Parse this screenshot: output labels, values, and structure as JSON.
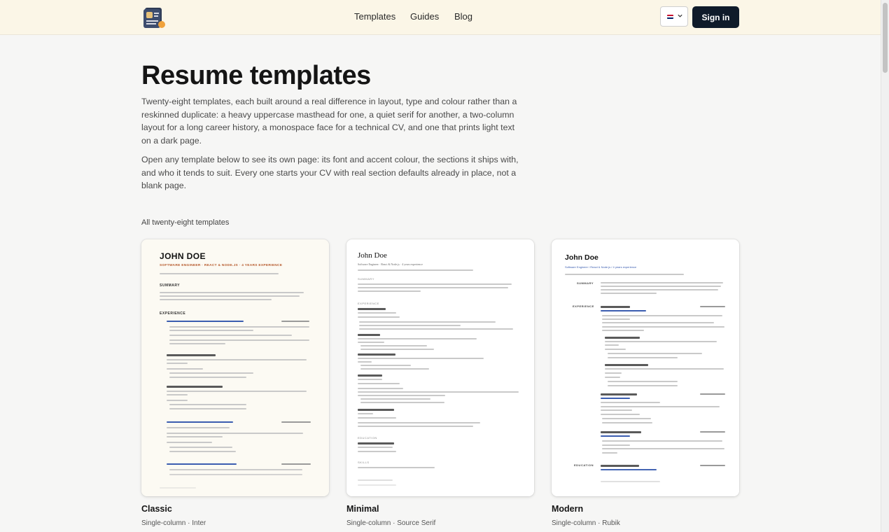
{
  "header": {
    "nav": [
      "Templates",
      "Guides",
      "Blog"
    ],
    "signin_label": "Sign in",
    "language_flag": "uk-flag"
  },
  "hero": {
    "title": "Resume templates",
    "paragraph1": "Twenty-eight templates, each built around a real difference in layout, type and colour rather than a reskinned duplicate: a heavy uppercase masthead for one, a quiet serif for another, a two-column layout for a long career history, a monospace face for a technical CV, and one that prints light text on a dark page.",
    "paragraph2": "Open any template below to see its own page: its font and accent colour, the sections it ships with, and who it tends to suit. Every one starts your CV with real section defaults already in place, not a blank page."
  },
  "gallery": {
    "count_label": "All twenty-eight templates",
    "templates": [
      {
        "name": "Classic",
        "meta": "Single-column · Inter",
        "preview": {
          "name": "JOHN DOE",
          "headline": "SOFTWARE ENGINEER · REACT & NODE.JS · 4 YEARS EXPERIENCE",
          "sections": [
            "SUMMARY",
            "EXPERIENCE"
          ],
          "accent": "#b65a2c"
        }
      },
      {
        "name": "Minimal",
        "meta": "Single-column · Source Serif",
        "preview": {
          "name": "John Doe",
          "headline": "Software Engineer · React & Node.js · 4 years experience",
          "sections": [
            "SUMMARY",
            "EXPERIENCE",
            "EDUCATION",
            "SKILLS"
          ],
          "accent": "#555555"
        }
      },
      {
        "name": "Modern",
        "meta": "Single-column · Rubik",
        "preview": {
          "name": "John Doe",
          "headline": "Software Engineer / React & Node.js / 4 years experience",
          "sections": [
            "SUMMARY",
            "EXPERIENCE",
            "EDUCATION"
          ],
          "accent": "#3b5db0"
        }
      }
    ]
  }
}
